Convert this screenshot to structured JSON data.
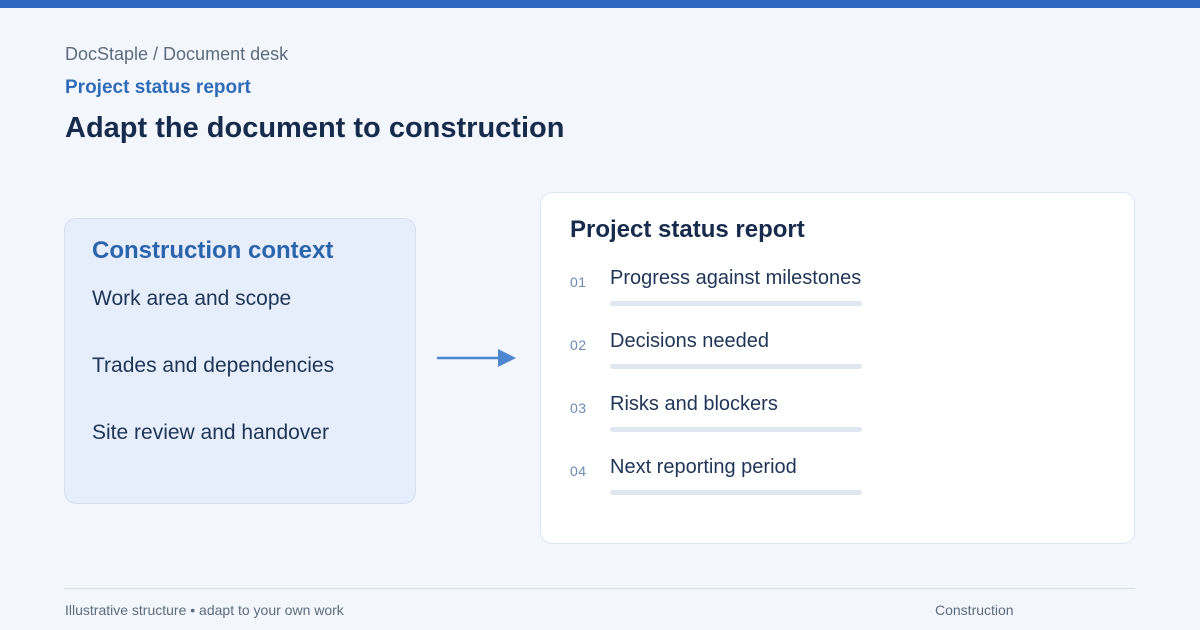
{
  "header": {
    "breadcrumb": "DocStaple / Document desk",
    "document_type": "Project status report",
    "title": "Adapt the document to construction"
  },
  "context": {
    "title": "Construction context",
    "items": [
      "Work area and scope",
      "Trades and dependencies",
      "Site review and handover"
    ]
  },
  "report": {
    "title": "Project status report",
    "sections": [
      {
        "number": "01",
        "label": "Progress against milestones"
      },
      {
        "number": "02",
        "label": "Decisions needed"
      },
      {
        "number": "03",
        "label": "Risks and blockers"
      },
      {
        "number": "04",
        "label": "Next reporting period"
      }
    ]
  },
  "footer": {
    "note": "Illustrative structure • adapt to your own work",
    "tag": "Construction"
  },
  "colors": {
    "accent": "#2d67be",
    "background": "#f3f7fd",
    "context_card": "#e6eefb",
    "report_card": "#ffffff",
    "heading": "#172b4d"
  },
  "icons": {
    "connector": "arrow-right-icon"
  }
}
